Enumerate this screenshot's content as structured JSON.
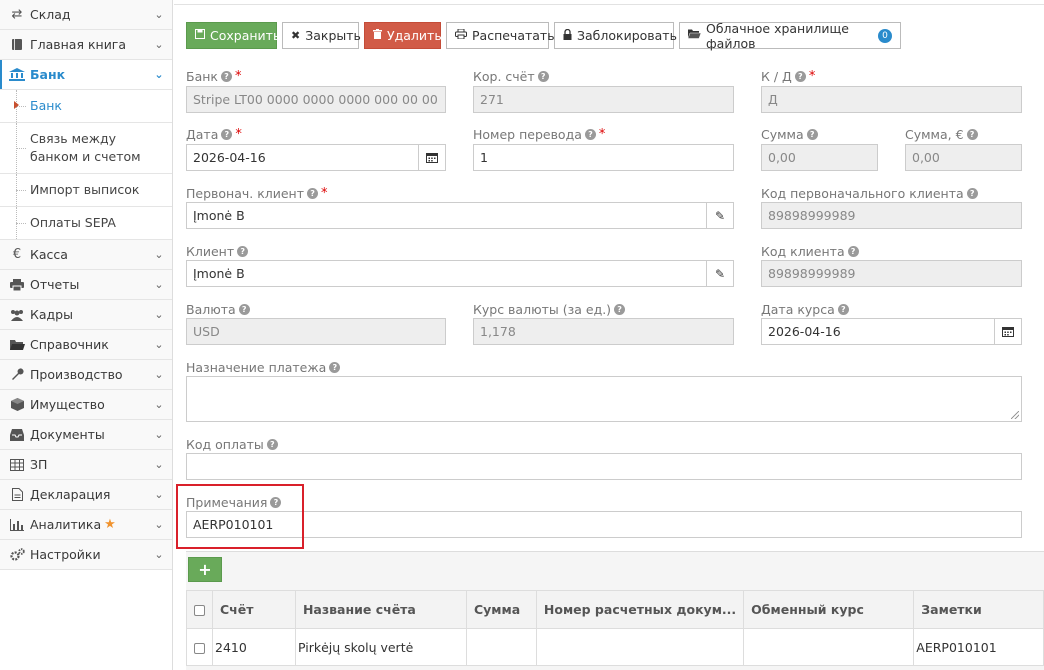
{
  "sidebar": {
    "items": [
      {
        "label": "Склад",
        "icon": "exchange-icon"
      },
      {
        "label": "Главная книга",
        "icon": "book-icon"
      },
      {
        "label": "Банк",
        "icon": "bank-icon"
      },
      {
        "label": "Касса",
        "icon": "euro-icon"
      },
      {
        "label": "Отчеты",
        "icon": "printer-icon"
      },
      {
        "label": "Кадры",
        "icon": "users-icon"
      },
      {
        "label": "Справочник",
        "icon": "folder-icon"
      },
      {
        "label": "Производство",
        "icon": "wrench-icon"
      },
      {
        "label": "Имущество",
        "icon": "cube-icon"
      },
      {
        "label": "Документы",
        "icon": "inbox-icon"
      },
      {
        "label": "ЗП",
        "icon": "table-icon"
      },
      {
        "label": "Декларация",
        "icon": "file-icon"
      },
      {
        "label": "Аналитика",
        "icon": "bar-chart-icon"
      },
      {
        "label": "Настройки",
        "icon": "cogs-icon"
      }
    ],
    "bank_sub": [
      {
        "label": "Банк"
      },
      {
        "label": "Связь между банком и счетом"
      },
      {
        "label": "Импорт выписок"
      },
      {
        "label": "Оплаты SEPA"
      }
    ]
  },
  "toolbar": {
    "save": "Сохранить",
    "close": "Закрыть",
    "delete": "Удалить",
    "print": "Распечатать",
    "lock": "Заблокировать",
    "cloud": "Облачное хранилище файлов",
    "cloud_count": "0"
  },
  "form": {
    "bank": {
      "label": "Банк",
      "value": "Stripe LT00 0000 0000 0000 000 00 00"
    },
    "corr_account": {
      "label": "Кор. счёт",
      "value": "271"
    },
    "kd": {
      "label": "К / Д",
      "value": "Д"
    },
    "date": {
      "label": "Дата",
      "value": "2026-04-16"
    },
    "transfer_no": {
      "label": "Номер перевода",
      "value": "1"
    },
    "amount": {
      "label": "Сумма",
      "value": "0,00"
    },
    "amount_eur": {
      "label": "Сумма, €",
      "value": "0,00"
    },
    "orig_client": {
      "label": "Первонач. клиент",
      "value": "Įmonė B"
    },
    "orig_client_code": {
      "label": "Код первоначального клиента",
      "value": "89898999989"
    },
    "client": {
      "label": "Клиент",
      "value": "Įmonė B"
    },
    "client_code": {
      "label": "Код клиента",
      "value": "89898999989"
    },
    "currency": {
      "label": "Валюта",
      "value": "USD"
    },
    "rate": {
      "label": "Курс валюты (за ед.)",
      "value": "1,178"
    },
    "rate_date": {
      "label": "Дата курса",
      "value": "2026-04-16"
    },
    "purpose": {
      "label": "Назначение платежа",
      "value": ""
    },
    "payment_code": {
      "label": "Код оплаты",
      "value": ""
    },
    "notes": {
      "label": "Примечания",
      "value": "AERP010101"
    }
  },
  "table": {
    "add_label": "+",
    "columns": [
      "Счёт",
      "Название счёта",
      "Сумма",
      "Номер расчетных докум...",
      "Обменный курс",
      "Заметки"
    ],
    "rows": [
      {
        "account": "2410",
        "name": "Pirkėjų skolų vertė",
        "amount": "",
        "doc_no": "",
        "rate": "",
        "notes": "AERP010101"
      }
    ]
  },
  "colors": {
    "accent": "#2a8bcc",
    "save_green": "#69aa5a",
    "delete_red": "#d15b47",
    "highlight_red": "#d9202a",
    "star_orange": "#f0932f"
  }
}
